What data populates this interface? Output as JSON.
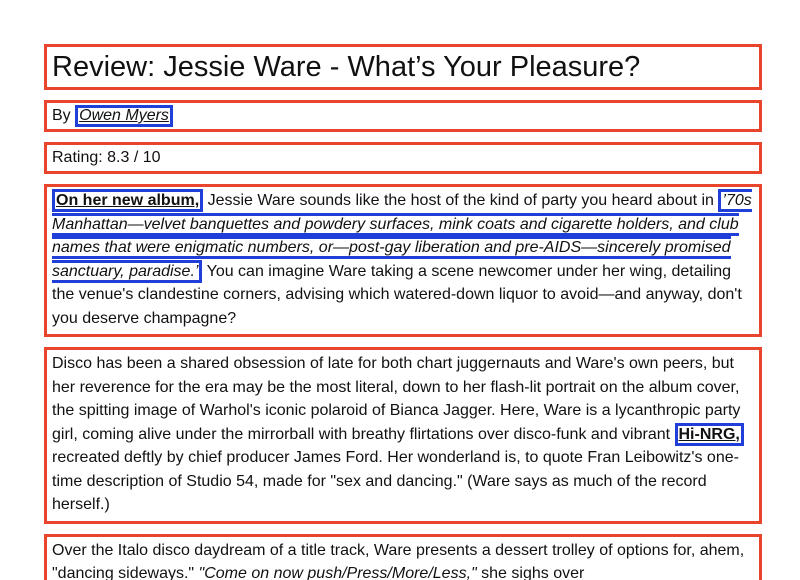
{
  "header": {
    "title": "Review: Jessie Ware - What’s Your Pleasure?"
  },
  "byline": {
    "prefix": "By",
    "author": "Owen Myers"
  },
  "rating": {
    "label": "Rating: 8.3 / 10"
  },
  "paragraphs": [
    {
      "lead_link": "On her new album,",
      "text1": " Jessie Ware sounds like the host of the kind of party you heard about in ",
      "quote": "’70s Manhattan—velvet banquettes and powdery surfaces, mink coats and cigarette holders, and club names that were enigmatic numbers, or—post-gay liberation and pre-AIDS—sincerely promised sanctuary, paradise.’",
      "text2": " You can imagine Ware taking a scene newcomer under her wing, detailing the venue's clandestine corners, advising which watered-down liquor to avoid—and anyway, don't you deserve champagne?"
    },
    {
      "text1": "Disco has been a shared obsession of late for both chart juggernauts and Ware's own peers, but her reverence for the era may be the most literal, down to her flash-lit portrait on the album cover, the spitting image of Warhol's iconic polaroid of Bianca Jagger. Here, Ware is a lycanthropic party girl, coming alive under the mirrorball with breathy flirtations over disco-funk and vibrant ",
      "link": "Hi-NRG,",
      "text2": " recreated deftly by chief producer James Ford. Her wonderland is, to quote Fran Leibowitz's one-time description of Studio 54, made for \"sex and dancing.\" (Ware says as much of the record herself.)"
    },
    {
      "text1": "Over the Italo disco daydream of a title track, Ware presents a dessert trolley of options for, ahem, \"dancing sideways.\" ",
      "quote": "\"Come on now push/Press/More/Less,\"",
      "text2": " she sighs over"
    }
  ],
  "colors": {
    "box_border": "#e8452c",
    "highlight_border": "#1f3fd8"
  }
}
